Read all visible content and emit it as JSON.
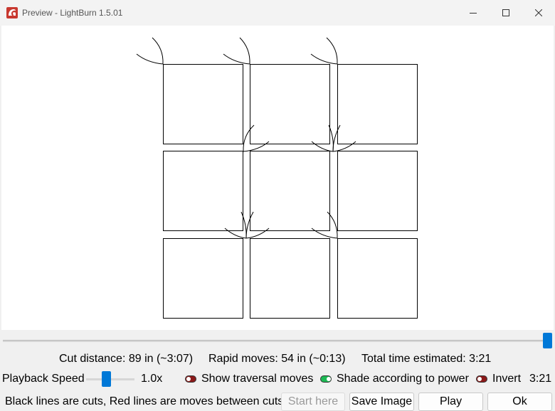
{
  "window": {
    "title": "Preview - LightBurn 1.5.01",
    "brand_color": "#c8382f"
  },
  "preview": {
    "cut_color": "#000000",
    "move_color": "#cc0000"
  },
  "timeline": {
    "position": 1.0
  },
  "stats": {
    "cut_distance": "Cut distance: 89 in (~3:07)",
    "rapid_moves": "Rapid moves: 54 in (~0:13)",
    "total_time": "Total time estimated: 3:21"
  },
  "playback": {
    "label": "Playback Speed",
    "speed": "1.0x",
    "slider_level": 0.4,
    "current_time": "3:21"
  },
  "toggles": {
    "traversal": {
      "label": "Show traversal moves",
      "on": false,
      "color": "#8b1a1a"
    },
    "shade": {
      "label": "Shade according to power",
      "on": true,
      "color": "#1db954"
    },
    "invert": {
      "label": "Invert",
      "on": false,
      "color": "#8b1a1a"
    }
  },
  "legend": "Black lines are cuts, Red lines are moves between cuts",
  "buttons": {
    "start_here": "Start here",
    "save_image": "Save Image",
    "play": "Play",
    "ok": "Ok"
  },
  "icons": {
    "app": "lightburn-logo-icon",
    "minimize": "minimize-icon",
    "maximize": "maximize-icon",
    "close": "close-icon"
  }
}
